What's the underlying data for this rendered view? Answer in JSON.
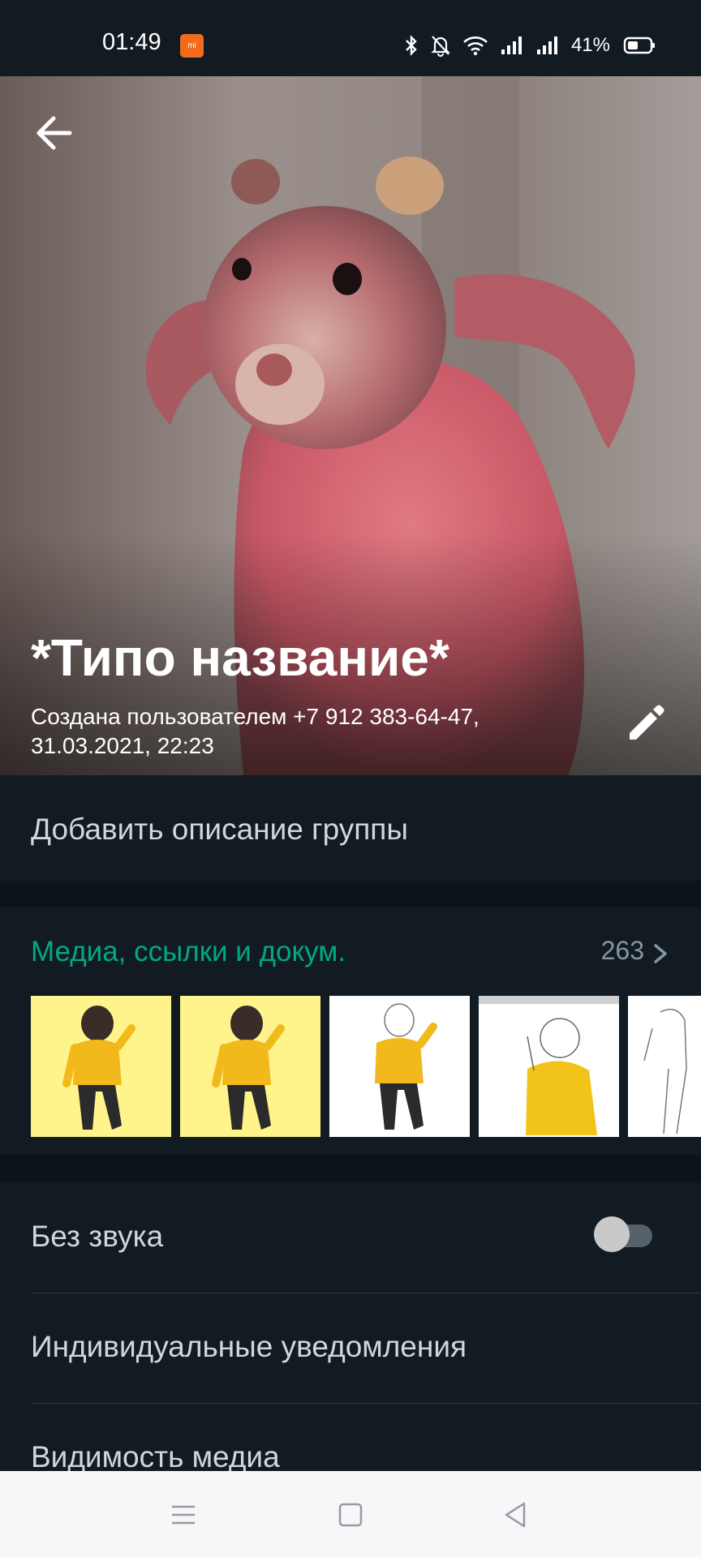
{
  "status_bar": {
    "time": "01:49",
    "battery": "41%",
    "icons": [
      "mi-notification-icon",
      "bluetooth-icon",
      "mute-bell-icon",
      "wifi-icon",
      "signal-icon",
      "signal-icon",
      "battery-icon"
    ]
  },
  "header": {
    "title": "*Типо название*",
    "created_by": "Создана пользователем +7 912 383-64-47, 31.03.2021, 22:23",
    "back_icon": "arrow-left-icon",
    "edit_icon": "pencil-icon"
  },
  "description": {
    "placeholder": "Добавить описание группы"
  },
  "media": {
    "title": "Медиа, ссылки и докум.",
    "count": "263",
    "thumbnails": [
      "yellow-background-drawing",
      "yellow-background-drawing",
      "white-background-drawing",
      "sketch-drawing",
      "line-sketch"
    ]
  },
  "settings": {
    "mute_label": "Без звука",
    "mute_on": false,
    "custom_notifications_label": "Индивидуальные уведомления",
    "media_visibility_label": "Видимость медиа"
  },
  "nav_bar": {
    "icons": [
      "menu-icon",
      "home-square-icon",
      "back-triangle-icon"
    ]
  },
  "colors": {
    "background": "#121b22",
    "section_gap": "#0b141a",
    "accent": "#00a884",
    "secondary_text": "#8696a0"
  }
}
